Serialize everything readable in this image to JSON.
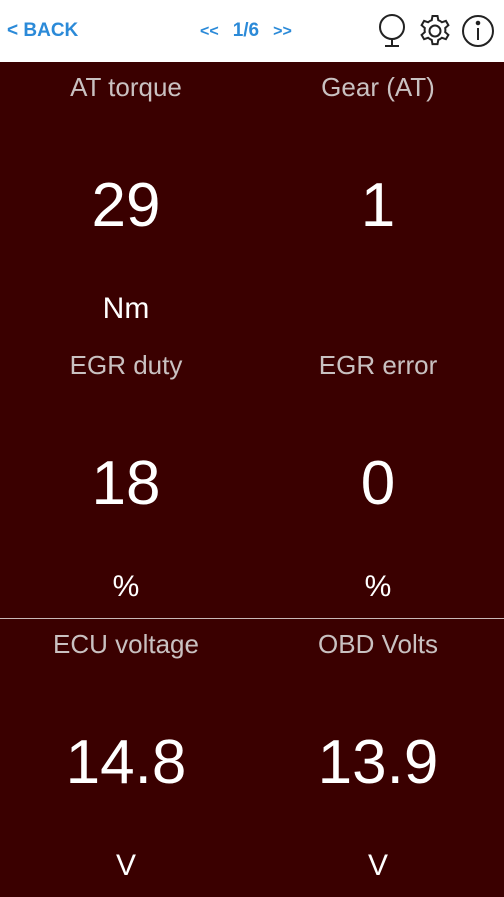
{
  "header": {
    "back_label": "< BACK",
    "prev_label": "<<",
    "page_indicator": "1/6",
    "next_label": ">>",
    "icons": [
      "mirror-icon",
      "gear-icon",
      "info-icon"
    ]
  },
  "colors": {
    "accent": "#2b8ad8",
    "background": "#3a0000",
    "label": "#c9c1c1",
    "value": "#ffffff"
  },
  "gauges": [
    {
      "label": "AT torque",
      "value": "29",
      "unit": "Nm"
    },
    {
      "label": "Gear (AT)",
      "value": "1",
      "unit": ""
    },
    {
      "label": "EGR duty",
      "value": "18",
      "unit": "%"
    },
    {
      "label": "EGR error",
      "value": "0",
      "unit": "%"
    },
    {
      "label": "ECU voltage",
      "value": "14.8",
      "unit": "V"
    },
    {
      "label": "OBD Volts",
      "value": "13.9",
      "unit": "V"
    }
  ]
}
